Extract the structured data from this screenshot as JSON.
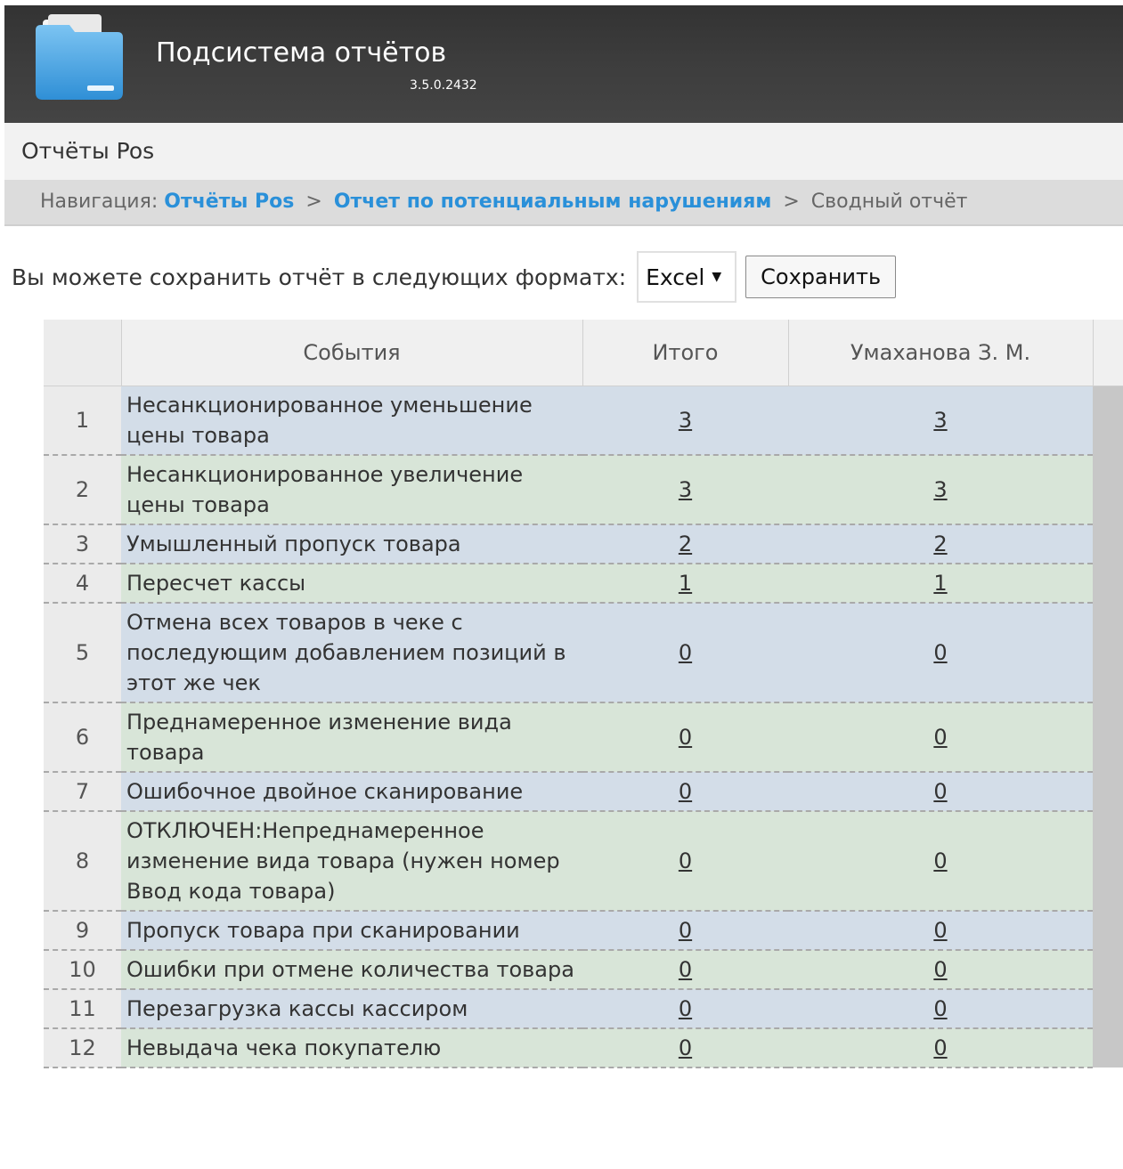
{
  "header": {
    "title": "Подсистема отчётов",
    "version": "3.5.0.2432",
    "logo_icon": "folder-icon"
  },
  "section": {
    "title": "Отчёты Pos"
  },
  "breadcrumb": {
    "label": "Навигация:",
    "link1": "Отчёты Pos",
    "separator": ">",
    "link2": "Отчет по потенциальным нарушениям",
    "current": "Сводный отчёт"
  },
  "save": {
    "prompt": "Вы можете сохранить отчёт в следующих форматх:",
    "format_selected": "Excel",
    "button_label": "Сохранить"
  },
  "table": {
    "columns": [
      "",
      "События",
      "Итого",
      "Умахanova З. М."
    ],
    "rows": [
      {
        "n": "1",
        "event": "Несанкционированное уменьшение цены товара",
        "total": "3",
        "person": "3"
      },
      {
        "n": "2",
        "event": "Несанкционированное увеличение цены товара",
        "total": "3",
        "person": "3"
      },
      {
        "n": "3",
        "event": "Умышленный пропуск товара",
        "total": "2",
        "person": "2"
      },
      {
        "n": "4",
        "event": "Пересчет кассы",
        "total": "1",
        "person": "1"
      },
      {
        "n": "5",
        "event": "Отмена всех товаров в чеке с последующим добавлением позиций в этот же чек",
        "total": "0",
        "person": "0"
      },
      {
        "n": "6",
        "event": "Преднамеренное изменение вида товара",
        "total": "0",
        "person": "0"
      },
      {
        "n": "7",
        "event": "Ошибочное двойное сканирование",
        "total": "0",
        "person": "0"
      },
      {
        "n": "8",
        "event": "ОТКЛЮЧЕН:Непреднамеренное изменение вида товара (нужен номер Ввод кода товара)",
        "total": "0",
        "person": "0"
      },
      {
        "n": "9",
        "event": "Пропуск товара при сканировании",
        "total": "0",
        "person": "0"
      },
      {
        "n": "10",
        "event": "Ошибки при отмене количества товара",
        "total": "0",
        "person": "0"
      },
      {
        "n": "11",
        "event": "Перезагрузка кассы кассиром",
        "total": "0",
        "person": "0"
      },
      {
        "n": "12",
        "event": "Невыдача чека покупателю",
        "total": "0",
        "person": "0"
      }
    ]
  }
}
